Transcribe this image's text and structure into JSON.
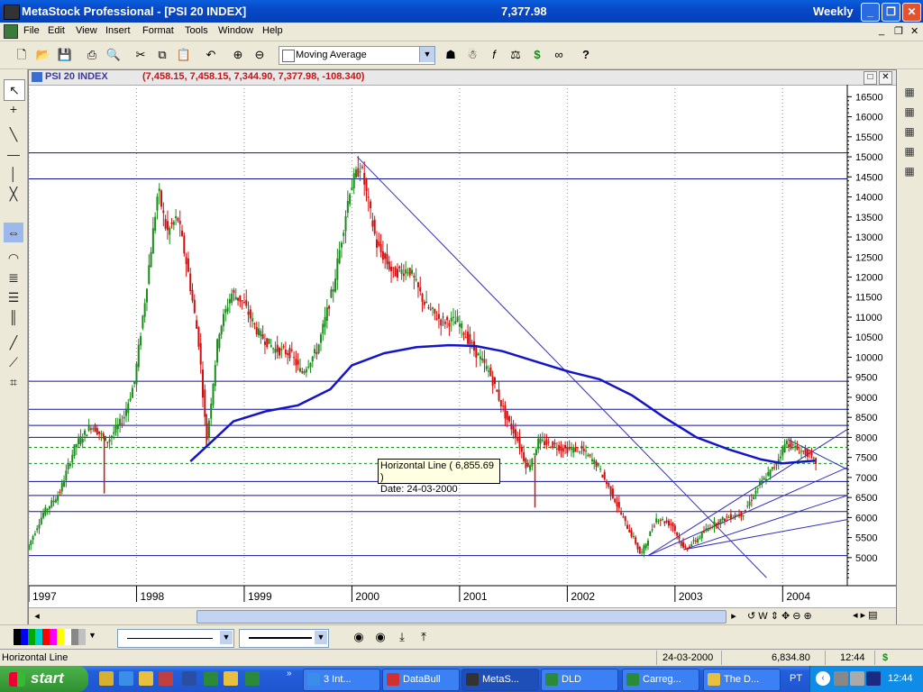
{
  "window": {
    "title": "MetaStock Professional - [PSI 20 INDEX]",
    "last_price": "7,377.98",
    "periodicity": "Weekly"
  },
  "menu": [
    "File",
    "Edit",
    "View",
    "Insert",
    "Format",
    "Tools",
    "Window",
    "Help"
  ],
  "toolbar": {
    "indicator_select": "Moving Average",
    "icons": [
      "new-icon",
      "open-icon",
      "save-icon",
      "print-icon",
      "print-preview-icon",
      "cut-icon",
      "copy-icon",
      "paste-icon",
      "undo-icon",
      "crosshair-icon",
      "zoom-icon",
      "indicator-icon",
      "expert-icon",
      "formula-icon",
      "explorer-icon",
      "dollar-icon",
      "binoculars-icon",
      "help-icon"
    ]
  },
  "chart": {
    "name": "PSI 20 INDEX",
    "values_text": "(7,458.15, 7,458.15, 7,344.90, 7,377.98, -108.340)",
    "tooltip_line1": "Horizontal Line ( 6,855.69 )",
    "tooltip_line2": "Date: 24-03-2000"
  },
  "chart_data": {
    "type": "candlestick",
    "security": "PSI 20 INDEX",
    "periodicity": "Weekly",
    "last_bar": {
      "open": 7458.15,
      "high": 7458.15,
      "low": 7344.9,
      "close": 7377.98,
      "change": -108.34
    },
    "x_axis_years": [
      "1997",
      "1998",
      "1999",
      "2000",
      "2001",
      "2002",
      "2003",
      "2004"
    ],
    "y_ticks": [
      5000,
      5500,
      6000,
      6500,
      7000,
      7500,
      8000,
      8500,
      9000,
      9500,
      10000,
      10500,
      11000,
      11500,
      12000,
      12500,
      13000,
      13500,
      14000,
      14500,
      15000,
      15500,
      16000,
      16500
    ],
    "y_range": [
      4300,
      16800
    ],
    "price_path": [
      [
        1997.0,
        5200
      ],
      [
        1997.15,
        6100
      ],
      [
        1997.3,
        6600
      ],
      [
        1997.45,
        7800
      ],
      [
        1997.6,
        8300
      ],
      [
        1997.75,
        7900
      ],
      [
        1997.9,
        8500
      ],
      [
        1998.0,
        9400
      ],
      [
        1998.1,
        11500
      ],
      [
        1998.22,
        14200
      ],
      [
        1998.3,
        13100
      ],
      [
        1998.4,
        13500
      ],
      [
        1998.5,
        12100
      ],
      [
        1998.6,
        10300
      ],
      [
        1998.67,
        7900
      ],
      [
        1998.78,
        10600
      ],
      [
        1998.9,
        11600
      ],
      [
        1999.0,
        11400
      ],
      [
        1999.15,
        10600
      ],
      [
        1999.3,
        10200
      ],
      [
        1999.45,
        10100
      ],
      [
        1999.55,
        9600
      ],
      [
        1999.7,
        10200
      ],
      [
        1999.85,
        11800
      ],
      [
        2000.0,
        14200
      ],
      [
        2000.1,
        14800
      ],
      [
        2000.25,
        12800
      ],
      [
        2000.4,
        12100
      ],
      [
        2000.55,
        12200
      ],
      [
        2000.7,
        11300
      ],
      [
        2000.85,
        10900
      ],
      [
        2001.0,
        10900
      ],
      [
        2001.15,
        10200
      ],
      [
        2001.3,
        9600
      ],
      [
        2001.45,
        8500
      ],
      [
        2001.55,
        8000
      ],
      [
        2001.65,
        7200
      ],
      [
        2001.75,
        7900
      ],
      [
        2001.9,
        7800
      ],
      [
        2002.0,
        7700
      ],
      [
        2002.15,
        7700
      ],
      [
        2002.3,
        7300
      ],
      [
        2002.45,
        6500
      ],
      [
        2002.55,
        5900
      ],
      [
        2002.65,
        5400
      ],
      [
        2002.7,
        5050
      ],
      [
        2002.85,
        6000
      ],
      [
        2003.0,
        5800
      ],
      [
        2003.1,
        5200
      ],
      [
        2003.2,
        5400
      ],
      [
        2003.35,
        5800
      ],
      [
        2003.5,
        6000
      ],
      [
        2003.65,
        6100
      ],
      [
        2003.8,
        6800
      ],
      [
        2003.95,
        7300
      ],
      [
        2004.05,
        7900
      ],
      [
        2004.15,
        7700
      ],
      [
        2004.25,
        7600
      ],
      [
        2004.32,
        7378
      ]
    ],
    "moving_average": [
      [
        1998.5,
        7400
      ],
      [
        1998.7,
        7900
      ],
      [
        1998.9,
        8400
      ],
      [
        1999.2,
        8650
      ],
      [
        1999.5,
        8800
      ],
      [
        1999.8,
        9200
      ],
      [
        2000.0,
        9800
      ],
      [
        2000.3,
        10100
      ],
      [
        2000.6,
        10250
      ],
      [
        2000.9,
        10300
      ],
      [
        2001.15,
        10280
      ],
      [
        2001.4,
        10150
      ],
      [
        2001.7,
        9900
      ],
      [
        2002.0,
        9650
      ],
      [
        2002.3,
        9450
      ],
      [
        2002.6,
        9050
      ],
      [
        2002.9,
        8500
      ],
      [
        2003.2,
        8000
      ],
      [
        2003.5,
        7700
      ],
      [
        2003.8,
        7450
      ],
      [
        2004.0,
        7350
      ],
      [
        2004.3,
        7420
      ]
    ],
    "horizontal_lines": [
      15100,
      14450,
      9400,
      8700,
      8300,
      8000,
      7750,
      7350,
      6900,
      6550,
      6150,
      5050
    ],
    "dashed_lines": [
      7750,
      7350
    ],
    "spikes": [
      [
        1997.7,
        6600
      ],
      [
        1998.65,
        7750
      ],
      [
        2001.7,
        6250
      ]
    ]
  },
  "status": {
    "left": "Horizontal Line",
    "date": "24-03-2000",
    "value": "6,834.80",
    "time": "12:44",
    "currency": "$"
  },
  "taskbar": {
    "start_label": "start",
    "tasks": [
      "3 Int...",
      "DataBull",
      "MetaS...",
      "DLD",
      "Carreg...",
      "The D..."
    ],
    "lang": "PT",
    "clock": "12:44"
  },
  "colors": {
    "candle_up": "#1a8a1a",
    "candle_down": "#d01010",
    "moving_average": "#1414c8",
    "hlines": "#1010a0",
    "trendlines": "#3030c0"
  }
}
